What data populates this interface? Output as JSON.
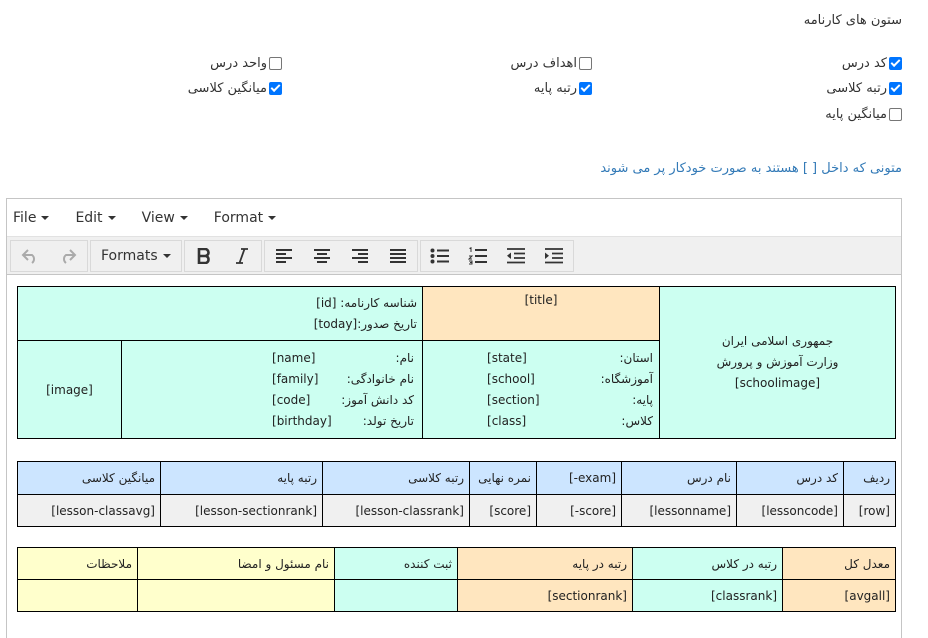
{
  "columns_section": {
    "title": "ستون های کارنامه",
    "options": [
      {
        "label": "کد درس",
        "checked": true
      },
      {
        "label": "اهداف درس",
        "checked": false
      },
      {
        "label": "واحد درس",
        "checked": false
      },
      {
        "label": "رتبه کلاسی",
        "checked": true
      },
      {
        "label": "رتبه پایه",
        "checked": true
      },
      {
        "label": "میانگین کلاسی",
        "checked": true
      },
      {
        "label": "میانگین پایه",
        "checked": false
      }
    ]
  },
  "note": "متونی که داخل [ ] هستند به صورت خودکار پر می شوند",
  "editor": {
    "menus": [
      "File",
      "Edit",
      "View",
      "Format"
    ],
    "toolbar": {
      "formats_label": "Formats"
    }
  },
  "report": {
    "header": {
      "org_line1": "جمهوری اسلامی ایران",
      "org_line2": "وزارت آموزش و پرورش",
      "org_image": "[schoolimage]",
      "title": "[title]",
      "report_id_label": "شناسه کارنامه:",
      "report_id_value": "[id]",
      "issue_date_label": "تاریخ صدور:",
      "issue_date_value": "[today]",
      "school_info": [
        {
          "label": "استان:",
          "value": "[state]"
        },
        {
          "label": "آموزشگاه:",
          "value": "[school]"
        },
        {
          "label": "پایه:",
          "value": "[section]"
        },
        {
          "label": "کلاس:",
          "value": "[class]"
        }
      ],
      "student_info": [
        {
          "label": "نام:",
          "value": "[name]"
        },
        {
          "label": "نام خانوادگی:",
          "value": "[family]"
        },
        {
          "label": "کد دانش آموز:",
          "value": "[code]"
        },
        {
          "label": "تاریخ تولد:",
          "value": "[birthday]"
        }
      ],
      "student_image": "[image]"
    },
    "lessons": {
      "headers": [
        "ردیف",
        "کد درس",
        "نام درس",
        "[-exam]",
        "نمره نهایی",
        "رتبه کلاسی",
        "رتبه پایه",
        "میانگین کلاسی"
      ],
      "row": [
        "[row]",
        "[lessoncode]",
        "[lessonname]",
        "[-score]",
        "[score]",
        "[lesson-classrank]",
        "[lesson-sectionrank]",
        "[lesson-classavg]"
      ]
    },
    "summary": {
      "headers": [
        "معدل کل",
        "رتبه در کلاس",
        "رتبه در پایه",
        "ثبت کننده",
        "نام مسئول و امضا",
        "ملاحظات"
      ],
      "values": [
        "[avgall]",
        "[classrank]",
        "[sectionrank]",
        "",
        "",
        ""
      ],
      "colors": [
        "#ffe6bf",
        "#ccfff1",
        "#ffe6bf",
        "#ccfff1",
        "#ffffcc",
        "#ffffcc"
      ]
    }
  }
}
